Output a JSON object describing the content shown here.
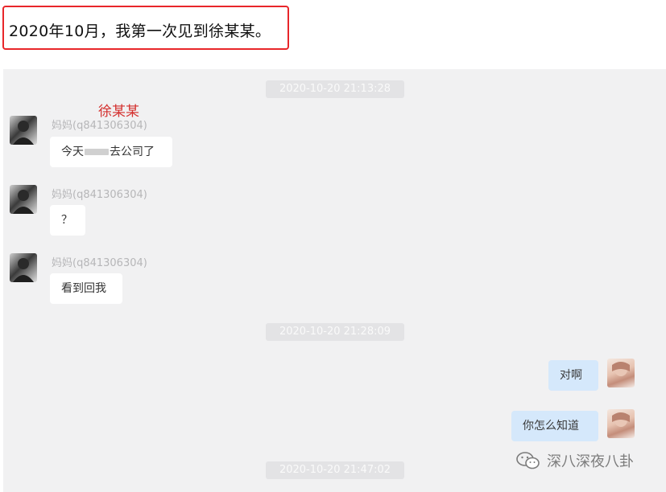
{
  "caption": "2020年10月，我第一次见到徐某某。",
  "annotation": "徐某某",
  "timestamps": [
    "2020-10-20 21:13:28",
    "2020-10-20 21:28:09",
    "2020-10-20 21:47:02"
  ],
  "messages": [
    {
      "sender": "妈妈(q841306304)",
      "text_before": "今天",
      "text_after": "去公司了"
    },
    {
      "sender": "妈妈(q841306304)",
      "text": "？"
    },
    {
      "sender": "妈妈(q841306304)",
      "text": "看到回我"
    },
    {
      "text": "对啊"
    },
    {
      "text": "你怎么知道"
    }
  ],
  "watermark": "深八深夜八卦",
  "colors": {
    "highlight_border": "#e8262a",
    "annotation": "#d4302e",
    "my_bubble": "#d5e8fb",
    "chat_bg": "#f1f1f2"
  }
}
